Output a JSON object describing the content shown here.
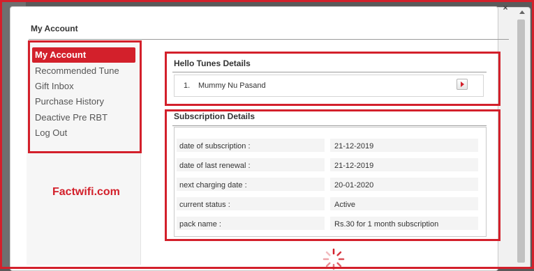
{
  "modal": {
    "title": "My Account",
    "close_glyph": "×"
  },
  "sidebar": {
    "items": [
      {
        "label": "My Account",
        "active": true
      },
      {
        "label": "Recommended Tune",
        "active": false
      },
      {
        "label": "Gift Inbox",
        "active": false
      },
      {
        "label": "Purchase History",
        "active": false
      },
      {
        "label": "Deactive Pre RBT",
        "active": false
      },
      {
        "label": "Log Out",
        "active": false
      }
    ]
  },
  "watermark": "Factwifi.com",
  "hello_tunes": {
    "title": "Hello Tunes Details",
    "items": [
      {
        "number": "1.",
        "name": "Mummy Nu Pasand"
      }
    ]
  },
  "subscription": {
    "title": "Subscription Details",
    "rows": [
      {
        "label": "date of subscription :",
        "value": "21-12-2019"
      },
      {
        "label": "date of last renewal :",
        "value": "21-12-2019"
      },
      {
        "label": "next charging date :",
        "value": "20-01-2020"
      },
      {
        "label": "current status :",
        "value": "Active"
      },
      {
        "label": "pack name :",
        "value": "Rs.30 for 1 month subscription"
      }
    ]
  },
  "colors": {
    "accent": "#d3202b",
    "row_background": "#f4f4f4"
  },
  "icons": {
    "play": "play-icon",
    "spinner": "loading-spinner-icon",
    "close": "close-icon"
  }
}
